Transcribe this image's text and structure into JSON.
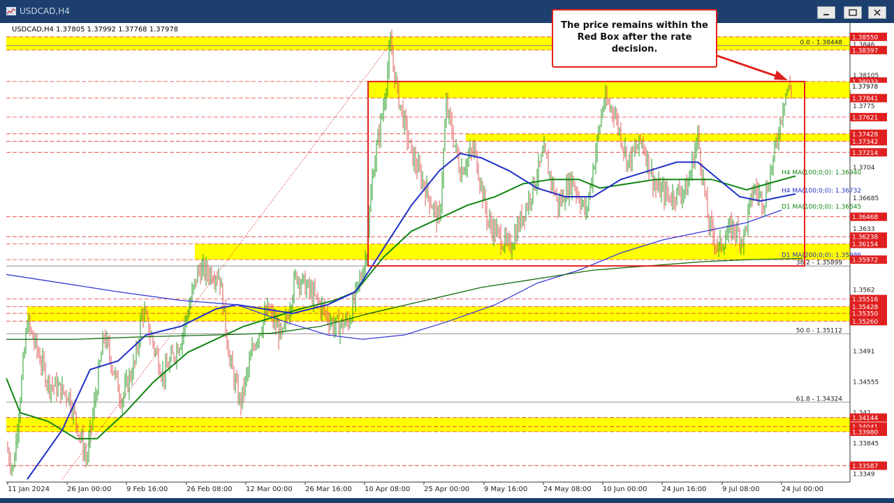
{
  "window": {
    "title": "USDCAD,H4",
    "buttons": [
      "minimize",
      "restore",
      "close"
    ]
  },
  "header_info": "USDCAD,H4  1.37805 1.37992 1.37768 1.37978",
  "annotation": {
    "text": "The price remains within the Red Box after the rate decision."
  },
  "colors": {
    "yellow_band": "#ffff00",
    "red_line": "#e23c3c",
    "red_box": "#e0201c",
    "ma_green": "#118511",
    "ma_blue": "#1f2fc7",
    "ma_green_dark": "#0d6b0d",
    "ma_blue_slow": "#3a3ad6",
    "candle_up": "#239b23",
    "candle_down": "#e25a5a",
    "price_label_red": "#e02020",
    "titlebar": "#1c3f6e"
  },
  "chart_data": {
    "type": "candlestick",
    "symbol": "USDCAD",
    "timeframe": "H4",
    "ohlc_last": {
      "open": 1.37805,
      "high": 1.37992,
      "low": 1.37768,
      "close": 1.37978
    },
    "ylim": [
      1.3343,
      1.3871
    ],
    "x_labels": [
      "11 Jan 2024",
      "26 Jan 00:00",
      "9 Feb 16:00",
      "26 Feb 08:00",
      "12 Mar 00:00",
      "26 Mar 16:00",
      "10 Apr 08:00",
      "25 Apr 00:00",
      "9 May 16:00",
      "24 May 08:00",
      "10 Jun 00:00",
      "24 Jun 16:00",
      "9 Jul 08:00",
      "24 Jul 00:00"
    ],
    "y_tick_labels": [
      1.3846,
      1.38105,
      1.3775,
      1.3704,
      1.36685,
      1.3633,
      1.3562,
      1.3491,
      1.34555,
      1.342,
      1.33845,
      1.3349
    ],
    "price_labels_red": [
      1.3855,
      1.38397,
      1.38033,
      1.37841,
      1.37621,
      1.37428,
      1.37342,
      1.37214,
      1.36468,
      1.36238,
      1.36154,
      1.35972,
      1.35516,
      1.35428,
      1.3535,
      1.3526,
      1.34144,
      1.34041,
      1.3398,
      1.33587
    ],
    "current_price": 1.37978,
    "fibonacci": [
      {
        "label": "0.0 - 1.38448",
        "value": 1.38448
      },
      {
        "label": "38.2 - 1.35899",
        "value": 1.35899
      },
      {
        "label": "50.0 - 1.35112",
        "value": 1.35112
      },
      {
        "label": "61.8 - 1.34324",
        "value": 1.34324
      }
    ],
    "moving_averages": [
      {
        "label": "H4 MA(100;0;0): 1.36940",
        "value": 1.3694
      },
      {
        "label": "H4 MA(100;0;0): 1.36732",
        "value": 1.36732
      },
      {
        "label": "D1 MA(100;0;0): 1.36545",
        "value": 1.36545
      },
      {
        "label": "D1 MA(200;0;0): 1.35986",
        "value": 1.35986
      }
    ],
    "yellow_zones": [
      [
        1.38397,
        1.3855
      ],
      [
        1.37841,
        1.38033
      ],
      [
        1.37342,
        1.37428
      ],
      [
        1.35972,
        1.36154
      ],
      [
        1.3526,
        1.35428
      ],
      [
        1.3398,
        1.34144
      ]
    ],
    "red_box": {
      "low": 1.35899,
      "high": 1.38033
    }
  }
}
